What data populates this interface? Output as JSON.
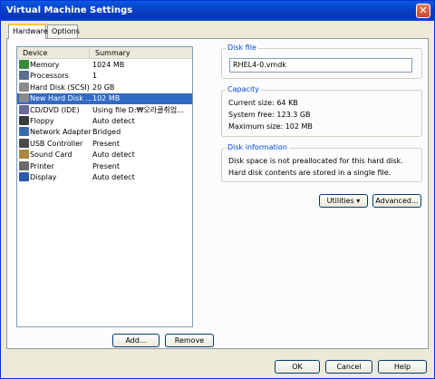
{
  "window": {
    "title": "Virtual Machine Settings",
    "close_glyph": "✕"
  },
  "tabs": [
    {
      "label": "Hardware"
    },
    {
      "label": "Options"
    }
  ],
  "device_list": {
    "headers": {
      "device": "Device",
      "summary": "Summary"
    },
    "rows": [
      {
        "device": "Memory",
        "summary": "1024 MB",
        "icon": "memory-icon",
        "color": "#3a8a3a"
      },
      {
        "device": "Processors",
        "summary": "1",
        "icon": "processor-icon",
        "color": "#5a6e8e"
      },
      {
        "device": "Hard Disk (SCSI)",
        "summary": "20 GB",
        "icon": "hard-disk-icon",
        "color": "#8a8a8a"
      },
      {
        "device": "New Hard Disk ...",
        "summary": "102 MB",
        "icon": "hard-disk-icon",
        "color": "#8a8a8a"
      },
      {
        "device": "CD/DVD (IDE)",
        "summary": "Using file D:₩오라클취업...",
        "icon": "cd-dvd-icon",
        "color": "#6a6a9a"
      },
      {
        "device": "Floppy",
        "summary": "Auto detect",
        "icon": "floppy-icon",
        "color": "#3a3a3a"
      },
      {
        "device": "Network Adapter",
        "summary": "Bridged",
        "icon": "network-adapter-icon",
        "color": "#3a6aa8"
      },
      {
        "device": "USB Controller",
        "summary": "Present",
        "icon": "usb-controller-icon",
        "color": "#4a4a4a"
      },
      {
        "device": "Sound Card",
        "summary": "Auto detect",
        "icon": "sound-card-icon",
        "color": "#a8883a"
      },
      {
        "device": "Printer",
        "summary": "Present",
        "icon": "printer-icon",
        "color": "#6a6a6a"
      },
      {
        "device": "Display",
        "summary": "Auto detect",
        "icon": "display-icon",
        "color": "#2a5aa8"
      }
    ],
    "selected_index": 3
  },
  "list_buttons": {
    "add": "Add...",
    "remove": "Remove"
  },
  "disk_file": {
    "title": "Disk file",
    "value": "RHEL4-0.vmdk"
  },
  "capacity": {
    "title": "Capacity",
    "current": "Current size: 64 KB",
    "free": "System free: 123.3 GB",
    "max": "Maximum size: 102 MB"
  },
  "disk_info": {
    "title": "Disk information",
    "line1": "Disk space is not preallocated for this hard disk.",
    "line2": "Hard disk contents are stored in a single file."
  },
  "panel_buttons": {
    "utilities": "Utilities ▾",
    "advanced": "Advanced..."
  },
  "footer_buttons": {
    "ok": "OK",
    "cancel": "Cancel",
    "help": "Help"
  },
  "colors": {
    "title_bar": "#0842c8",
    "selection": "#316ac5",
    "group_title": "#0046d5"
  }
}
